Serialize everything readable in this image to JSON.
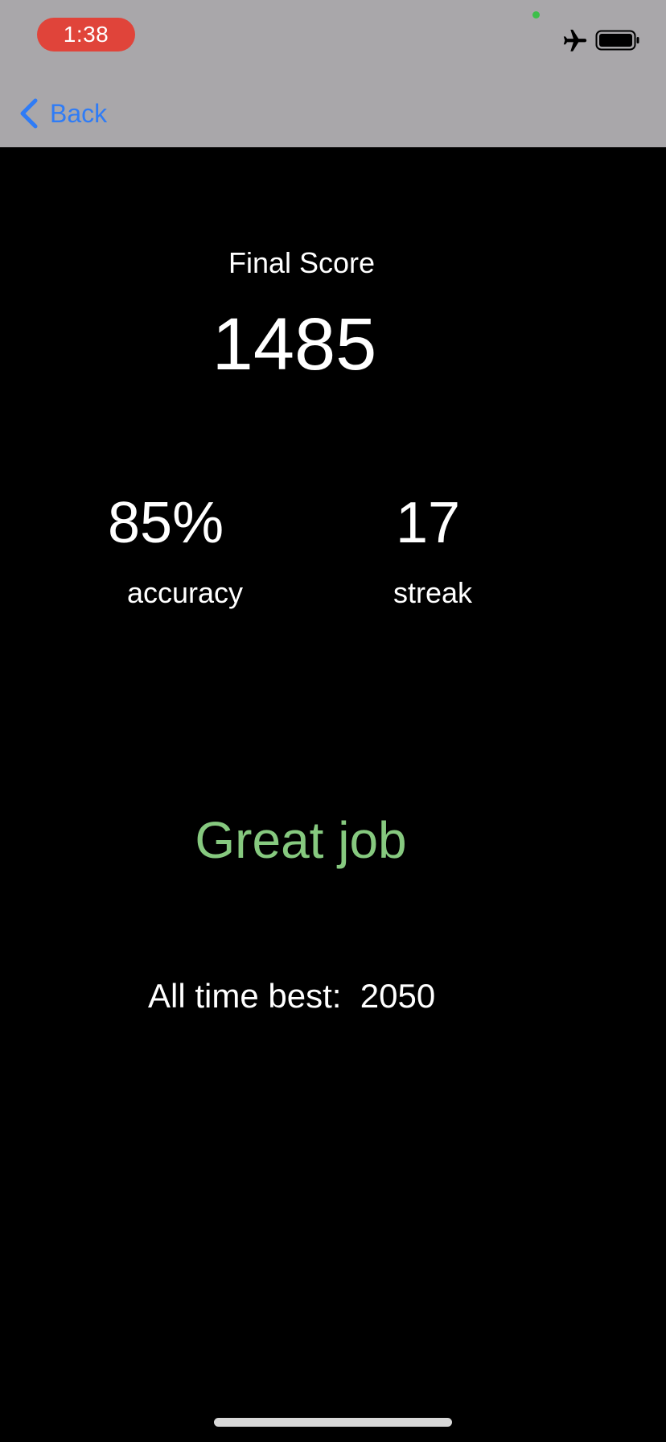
{
  "status_bar": {
    "time": "1:38",
    "icons": [
      "airplane-icon",
      "battery-icon"
    ],
    "colors": {
      "time_pill": "#e0443a",
      "privacy_dot": "#3dbf4a",
      "bar_background": "#a9a7aa"
    }
  },
  "nav": {
    "back_label": "Back",
    "back_icon": "chevron-left-icon",
    "accent": "#2f7cf6"
  },
  "results": {
    "final_score_label": "Final Score",
    "final_score": "1485",
    "accuracy_value": "85%",
    "accuracy_label": "accuracy",
    "streak_value": "17",
    "streak_label": "streak",
    "message": "Great job",
    "message_color": "#86c97f",
    "best_label": "All time best:",
    "best_value": "2050"
  }
}
